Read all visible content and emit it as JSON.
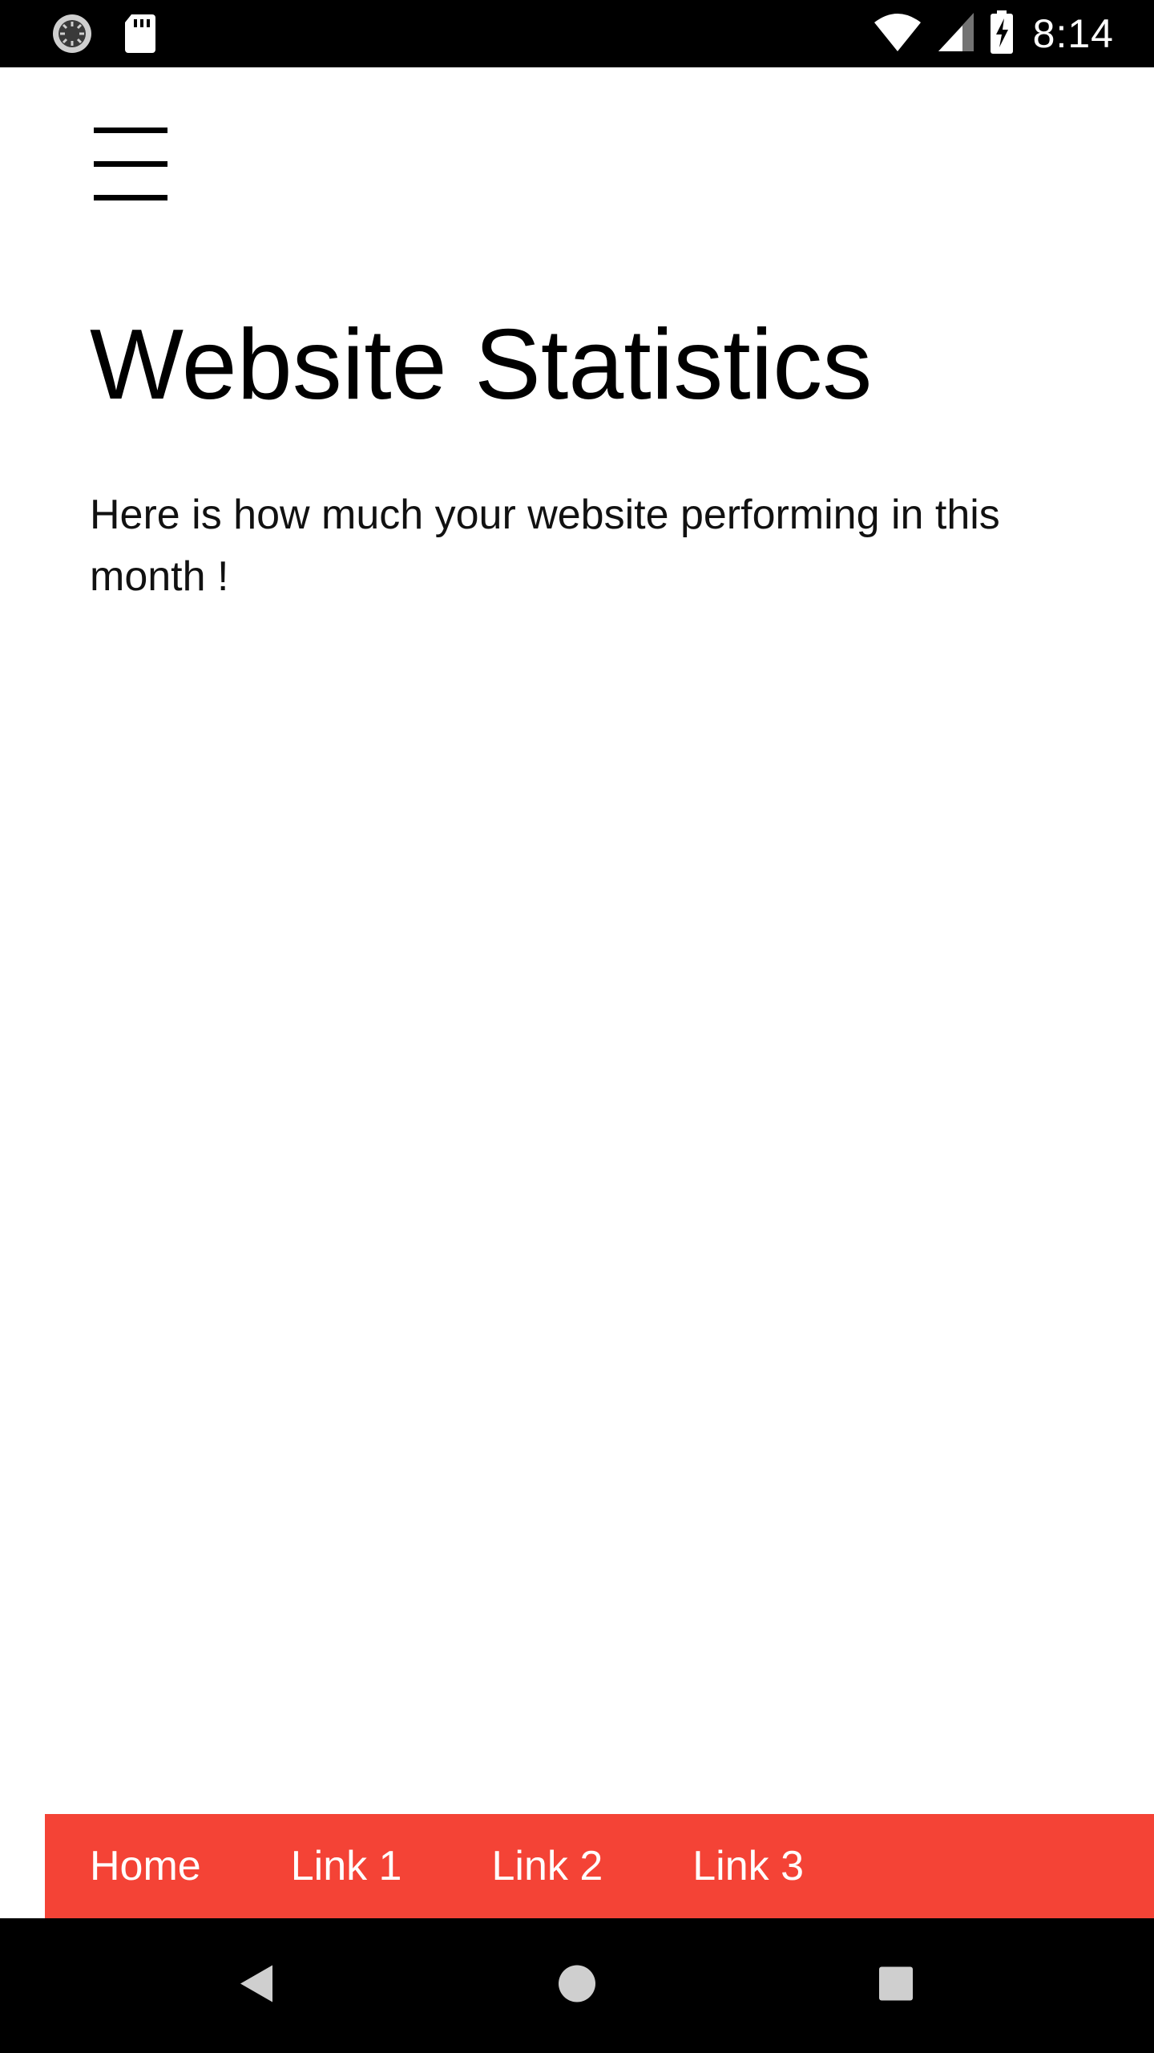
{
  "status_bar": {
    "time": "8:14",
    "icons": [
      "loading-icon",
      "sd-card-icon",
      "wifi-icon",
      "signal-icon",
      "battery-charging-icon"
    ]
  },
  "header": {
    "menu_icon": "hamburger-menu-icon"
  },
  "main": {
    "title": "Website Statistics",
    "description": "Here is how much your website performing in this month !"
  },
  "bottom_nav": {
    "background": "#f44336",
    "links": [
      {
        "label": "Home"
      },
      {
        "label": "Link 1"
      },
      {
        "label": "Link 2"
      },
      {
        "label": "Link 3"
      }
    ]
  },
  "system_nav": {
    "buttons": [
      "back-icon",
      "home-icon",
      "recents-icon"
    ]
  }
}
